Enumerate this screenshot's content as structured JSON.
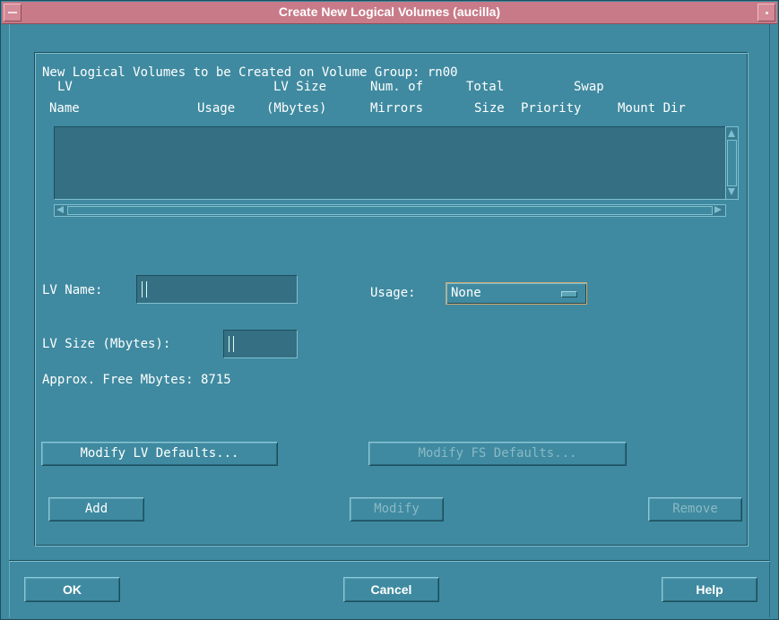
{
  "window": {
    "title": "Create New Logical Volumes (aucilla)",
    "icons": {
      "menu": "window-menu-icon",
      "minimize": "window-minimize-icon"
    }
  },
  "list": {
    "heading": "New Logical Volumes to be Created on Volume Group: rn00",
    "columns": [
      {
        "line1": "LV",
        "line2": "Name"
      },
      {
        "line1": "",
        "line2": "Usage"
      },
      {
        "line1": "LV Size",
        "line2": "(Mbytes)"
      },
      {
        "line1": "Num. of",
        "line2": "Mirrors"
      },
      {
        "line1": "Total",
        "line2": "Size"
      },
      {
        "line1": "Swap",
        "line2": "Priority"
      },
      {
        "line1": "",
        "line2": "Mount Dir"
      }
    ],
    "rows": []
  },
  "form": {
    "lv_name_label": "LV Name:",
    "lv_name_value": "",
    "usage_label": "Usage:",
    "usage_value": "None",
    "lv_size_label": "LV Size (Mbytes):",
    "lv_size_value": "",
    "free_label": "Approx. Free Mbytes: 8715"
  },
  "buttons": {
    "modify_lv_defaults": "Modify LV Defaults...",
    "modify_fs_defaults": "Modify FS Defaults...",
    "add": "Add",
    "modify": "Modify",
    "remove": "Remove",
    "ok": "OK",
    "cancel": "Cancel",
    "help": "Help"
  },
  "colors": {
    "background": "#3f8aa0",
    "titlebar": "#c87a88",
    "text": "#ffffff",
    "disabled_text": "#8ab9c6",
    "focus_border": "#d9a66a"
  }
}
